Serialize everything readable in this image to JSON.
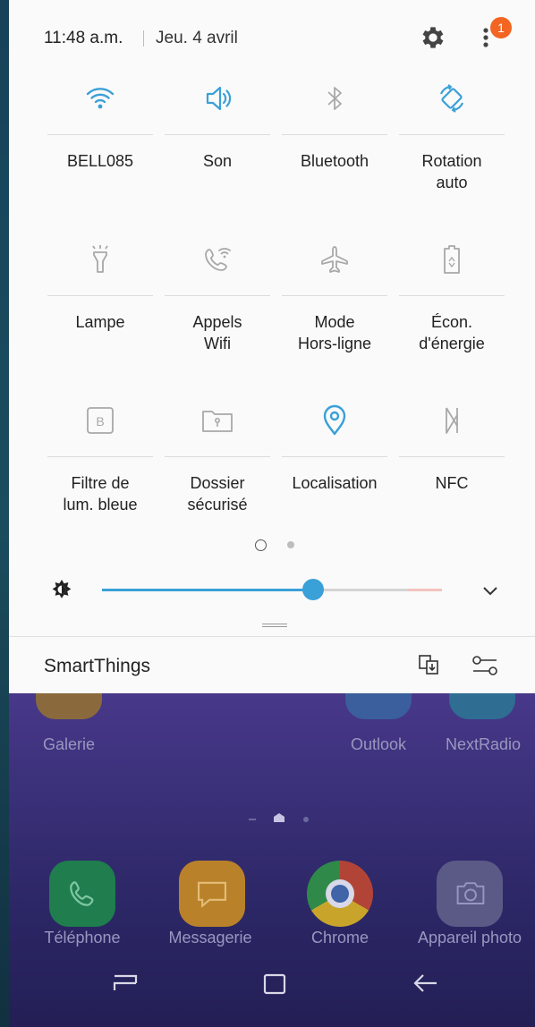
{
  "status": {
    "time": "11:48 a.m.",
    "date": "Jeu. 4 avril",
    "notification_count": "1"
  },
  "tiles": [
    {
      "label": "BELL085",
      "icon": "wifi-icon",
      "active": true
    },
    {
      "label": "Son",
      "icon": "sound-icon",
      "active": true
    },
    {
      "label": "Bluetooth",
      "icon": "bluetooth-icon",
      "active": false
    },
    {
      "label": "Rotation\nauto",
      "icon": "auto-rotate-icon",
      "active": true
    },
    {
      "label": "Lampe",
      "icon": "flashlight-icon",
      "active": false
    },
    {
      "label": "Appels\nWifi",
      "icon": "wifi-calling-icon",
      "active": false
    },
    {
      "label": "Mode\nHors-ligne",
      "icon": "airplane-icon",
      "active": false
    },
    {
      "label": "Écon.\nd'énergie",
      "icon": "power-saving-icon",
      "active": false
    },
    {
      "label": "Filtre de\nlum. bleue",
      "icon": "blue-light-filter-icon",
      "active": false
    },
    {
      "label": "Dossier\nsécurisé",
      "icon": "secure-folder-icon",
      "active": false
    },
    {
      "label": "Localisation",
      "icon": "location-icon",
      "active": true
    },
    {
      "label": "NFC",
      "icon": "nfc-icon",
      "active": false
    }
  ],
  "brightness": {
    "level": 0.62
  },
  "smartthings": {
    "label": "SmartThings"
  },
  "home": {
    "apps_top": [
      {
        "label": "Galerie"
      },
      {
        "label": "Outlook"
      },
      {
        "label": "NextRadio"
      }
    ],
    "dock": [
      {
        "label": "Téléphone"
      },
      {
        "label": "Messagerie"
      },
      {
        "label": "Chrome"
      },
      {
        "label": "Appareil photo"
      }
    ]
  },
  "colors": {
    "accent": "#3aa0d8",
    "inactive_icon": "#9e9e9e",
    "badge": "#f26522"
  }
}
